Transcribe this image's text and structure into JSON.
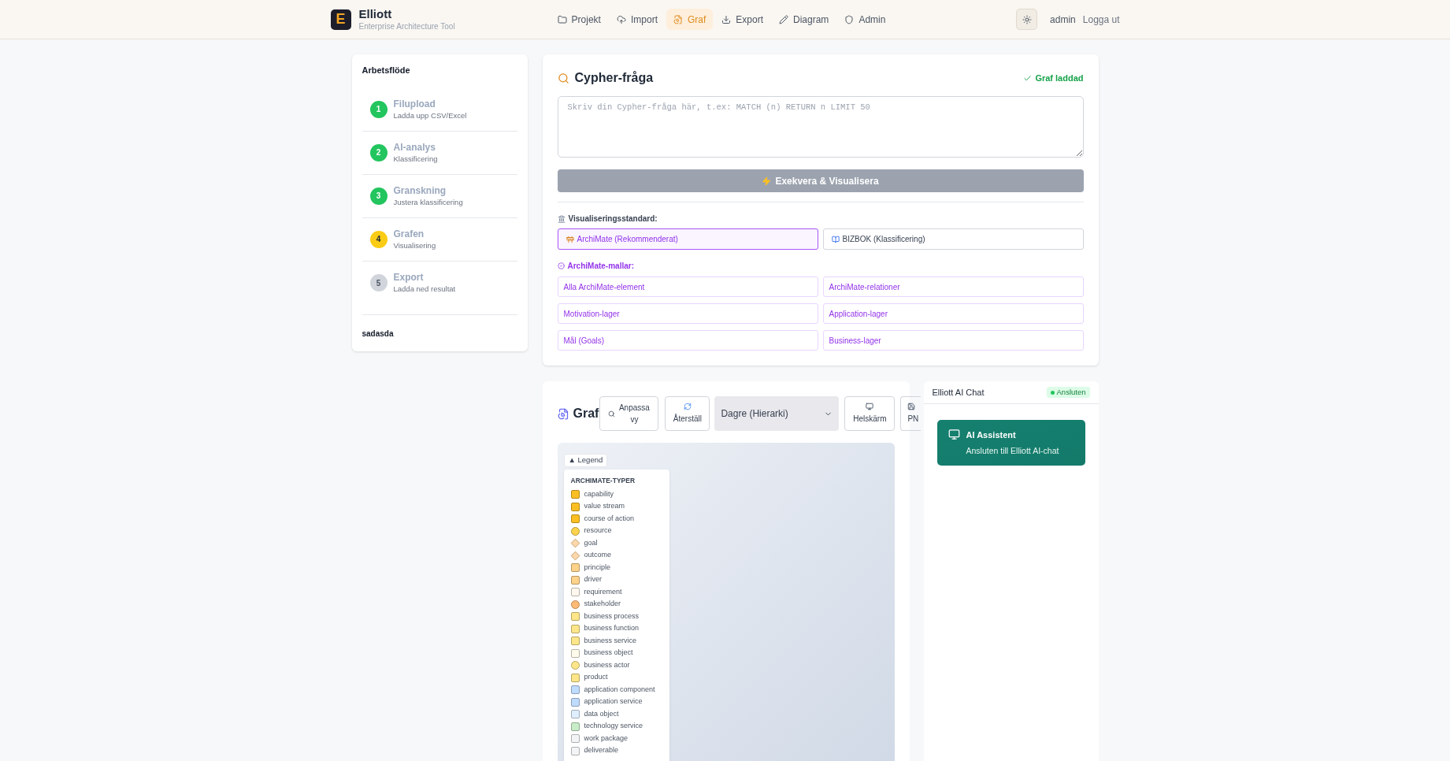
{
  "header": {
    "brand": "Elliott",
    "logo_letter": "E",
    "subtitle": "Enterprise Architecture Tool",
    "nav": [
      {
        "label": "Projekt",
        "selected": false
      },
      {
        "label": "Import",
        "selected": false
      },
      {
        "label": "Graf",
        "selected": true
      },
      {
        "label": "Export",
        "selected": false
      },
      {
        "label": "Diagram",
        "selected": false
      },
      {
        "label": "Admin",
        "selected": false
      }
    ],
    "user": "admin",
    "logout": "Logga ut"
  },
  "sidebar": {
    "title": "Arbetsflöde",
    "steps": [
      {
        "number": "1",
        "title": "Filupload",
        "subtitle": "Ladda upp CSV/Excel",
        "kind": "done"
      },
      {
        "number": "2",
        "title": "AI-analys",
        "subtitle": "Klassificering",
        "kind": "done"
      },
      {
        "number": "3",
        "title": "Granskning",
        "subtitle": "Justera klassificering",
        "kind": "done"
      },
      {
        "number": "4",
        "title": "Grafen",
        "subtitle": "Visualisering",
        "kind": "current"
      },
      {
        "number": "5",
        "title": "Export",
        "subtitle": "Ladda ned resultat",
        "kind": "pending"
      }
    ],
    "footer": "sadasda"
  },
  "query": {
    "title": "Cypher-fråga",
    "status": "Graf laddad",
    "placeholder": "Skriv din Cypher-fråga här, t.ex: MATCH (n) RETURN n LIMIT 50",
    "run_button": "Exekvera & Visualisera",
    "run_disabled": true,
    "standard_label": "Visualiseringsstandard:",
    "standards": [
      {
        "label": "ArchiMate (Rekommenderat)",
        "selected": true
      },
      {
        "label": "BIZBOK (Klassificering)",
        "selected": false
      }
    ],
    "templates_label": "ArchiMate-mallar:",
    "templates": [
      "Alla ArchiMate-element",
      "ArchiMate-relationer",
      "Motivation-lager",
      "Application-lager",
      "Mål (Goals)",
      "Business-lager"
    ]
  },
  "graph": {
    "title": "Graf",
    "toolbar": {
      "fit": "Anpassa vy",
      "reset": "Återställ",
      "layout": "Dagre (Hierarki)",
      "fullscreen": "Helskärm",
      "png": "PN"
    },
    "legend_toggle": "▲ Legend",
    "legend_title": "ARCHIMATE-TYPER",
    "legend": [
      {
        "label": "capability",
        "kind": "square",
        "color": "#fbbf24"
      },
      {
        "label": "value stream",
        "kind": "square",
        "color": "#fbbf24"
      },
      {
        "label": "course of action",
        "kind": "square",
        "color": "#fbbf24"
      },
      {
        "label": "resource",
        "kind": "circle",
        "color": "#fcd34d"
      },
      {
        "label": "goal",
        "kind": "diamond",
        "color": "#fed7aa"
      },
      {
        "label": "outcome",
        "kind": "diamond",
        "color": "#fed7aa"
      },
      {
        "label": "principle",
        "kind": "square",
        "color": "#fdd28a"
      },
      {
        "label": "driver",
        "kind": "square",
        "color": "#fdd28a"
      },
      {
        "label": "requirement",
        "kind": "square",
        "color": "#fff7ed"
      },
      {
        "label": "stakeholder",
        "kind": "circle",
        "color": "#fdba74"
      },
      {
        "label": "business process",
        "kind": "square",
        "color": "#fde68a"
      },
      {
        "label": "business function",
        "kind": "square",
        "color": "#fde68a"
      },
      {
        "label": "business service",
        "kind": "square",
        "color": "#fde68a"
      },
      {
        "label": "business object",
        "kind": "square",
        "color": "#fffbeb"
      },
      {
        "label": "business actor",
        "kind": "circle",
        "color": "#fde68a"
      },
      {
        "label": "product",
        "kind": "square",
        "color": "#fde68a"
      },
      {
        "label": "application component",
        "kind": "square",
        "color": "#bfdbfe"
      },
      {
        "label": "application service",
        "kind": "square",
        "color": "#bfdbfe"
      },
      {
        "label": "data object",
        "kind": "square",
        "color": "#e0efff"
      },
      {
        "label": "technology service",
        "kind": "square",
        "color": "#c8ecc8"
      },
      {
        "label": "work package",
        "kind": "square",
        "color": "#f3f4f6"
      },
      {
        "label": "deliverable",
        "kind": "square",
        "color": "#f3f4f6"
      }
    ]
  },
  "chat": {
    "title": "Elliott AI Chat",
    "status": "Ansluten",
    "connected": true,
    "assistant_title": "AI Assistent",
    "assistant_text": "Ansluten till Elliott AI-chat"
  }
}
